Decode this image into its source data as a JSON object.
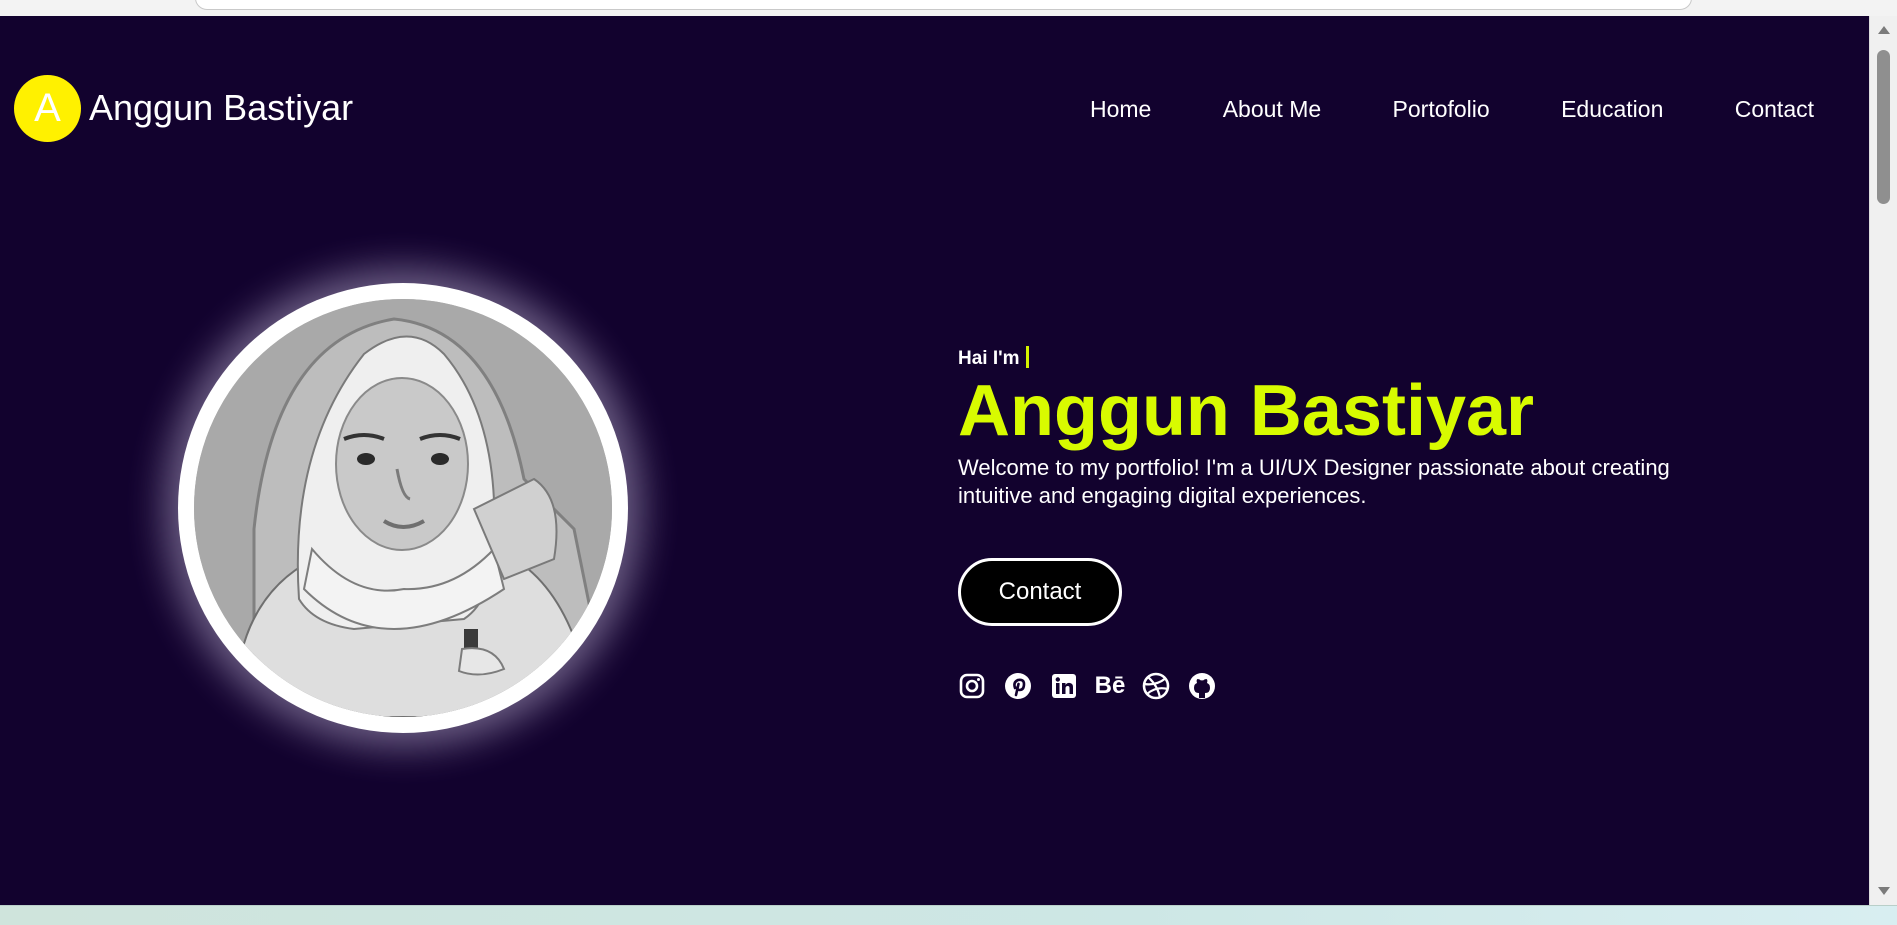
{
  "header": {
    "logo_letter": "A",
    "brand": "Anggun Bastiyar"
  },
  "nav": {
    "items": [
      "Home",
      "About Me",
      "Portofolio",
      "Education",
      "Contact"
    ]
  },
  "hero": {
    "greeting": "Hai I'm",
    "name": "Anggun Bastiyar",
    "description": "Welcome to my portfolio! I'm a UI/UX Designer passionate about creating intuitive and engaging digital experiences.",
    "cta_label": "Contact"
  },
  "socials": {
    "items": [
      "instagram-icon",
      "pinterest-icon",
      "linkedin-icon",
      "behance-icon",
      "dribbble-icon",
      "github-icon"
    ],
    "behance_text": "Bē"
  },
  "colors": {
    "background": "#12022e",
    "accent": "#d8fb00",
    "logo": "#fff100",
    "button": "#000000"
  }
}
